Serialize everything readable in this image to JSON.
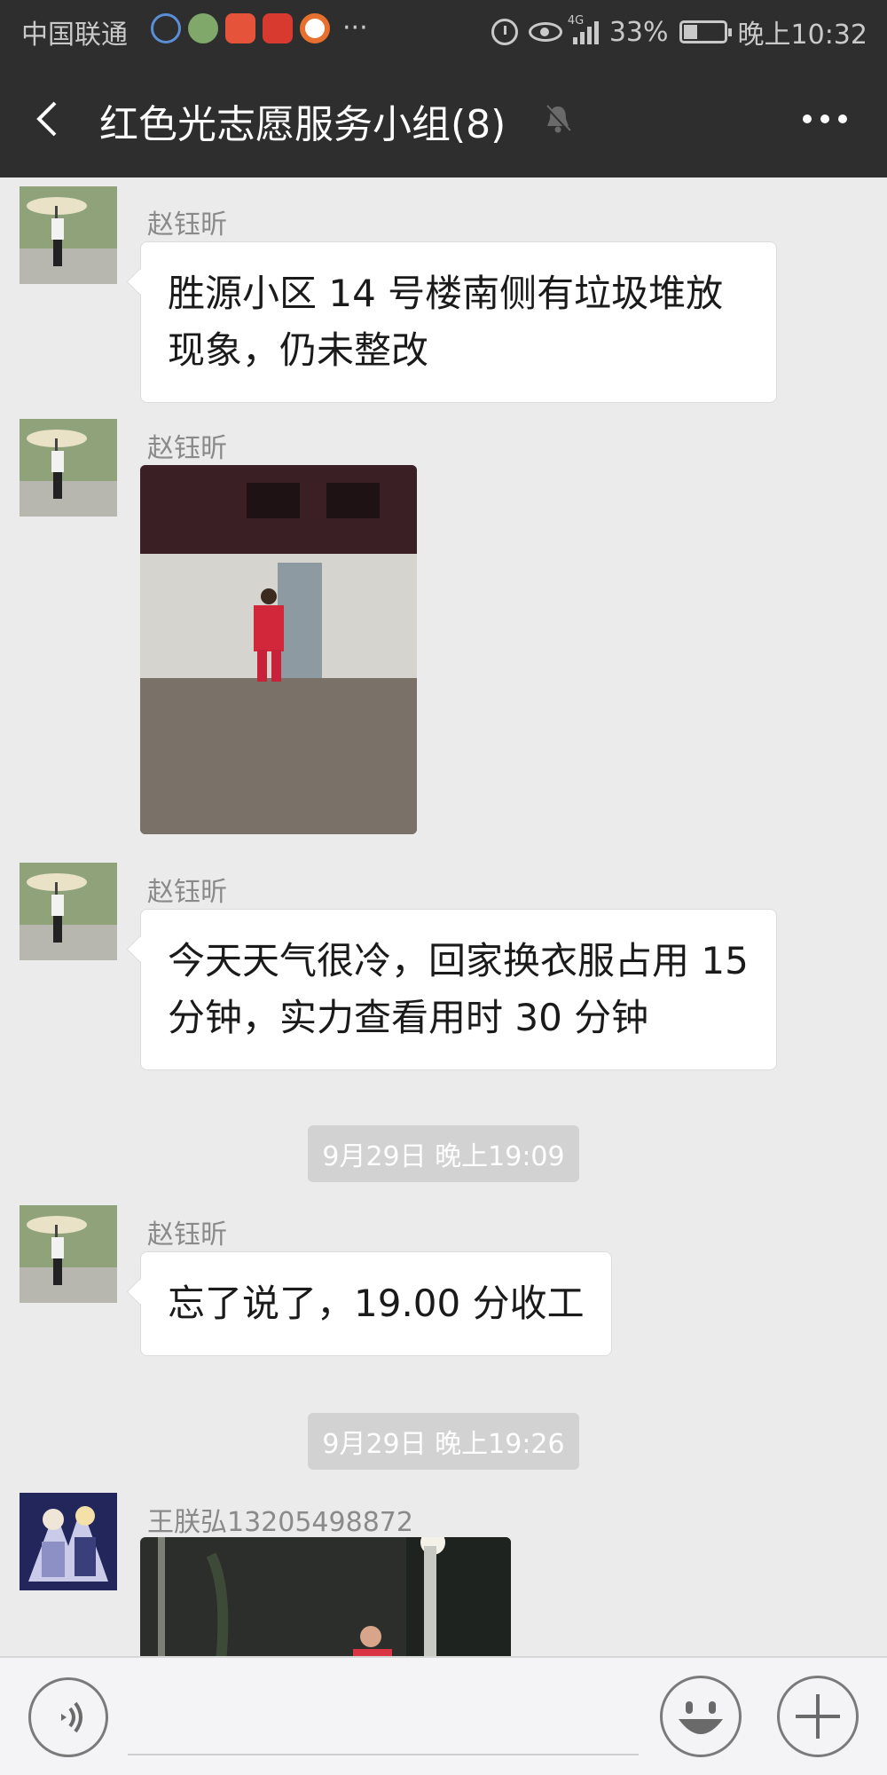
{
  "status_bar": {
    "carrier": "中国联通",
    "app_icons": [
      "headset-app-icon",
      "wechat-mini-app-icon",
      "mp-app-icon",
      "toutiao-app-icon",
      "news-app-icon"
    ],
    "more": "···",
    "network": "4G",
    "battery": "33%",
    "battery_level": 0.33,
    "time": "晚上10:32"
  },
  "header": {
    "title": "红色光志愿服务小组(8)",
    "muted": true
  },
  "messages": [
    {
      "type": "text",
      "sender": "赵钰昕",
      "text_line1": "胜源小区 14 号楼南侧有垃圾堆放",
      "text_line2": "现象，仍未整改"
    },
    {
      "type": "image",
      "sender": "赵钰昕"
    },
    {
      "type": "text",
      "sender": "赵钰昕",
      "text_line1": "今天天气很冷，回家换衣服占用 15",
      "text_line2": "分钟，实力查看用时 30 分钟"
    },
    {
      "type": "timestamp",
      "text": "9月29日 晚上19:09"
    },
    {
      "type": "text",
      "sender": "赵钰昕",
      "text_line1": "忘了说了，19.00 分收工"
    },
    {
      "type": "timestamp",
      "text": "9月29日 晚上19:26"
    },
    {
      "type": "image",
      "sender": "王朕弘13205498872"
    }
  ],
  "colors": {
    "bar_bg": "#2e2e2e",
    "chat_bg": "#ebebeb",
    "bubble_bg": "#ffffff",
    "timestamp_bg": "#d2d2d2"
  }
}
